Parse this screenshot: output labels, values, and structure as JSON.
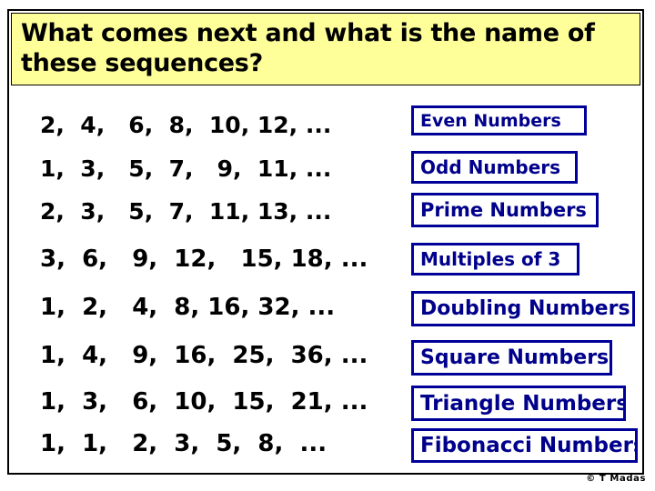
{
  "slide": {
    "title": "What comes next and what is the name of\nthese sequences?",
    "copyright": "© T Madas",
    "colors": {
      "banner_background": "#ffff99",
      "banner_border": "#000000",
      "label_border": "#000099",
      "label_text": "#00008b",
      "sequence_text": "#000000",
      "page_background": "#ffffff"
    }
  },
  "rows": [
    {
      "sequence": "2,  4,   6,  8,  10, 12, ...",
      "terms": [
        2,
        4,
        6,
        8,
        10,
        12
      ],
      "name": "Even Numbers"
    },
    {
      "sequence": "1,  3,   5,  7,   9,  11, ...",
      "terms": [
        1,
        3,
        5,
        7,
        9,
        11
      ],
      "name": "Odd Numbers"
    },
    {
      "sequence": "2,  3,   5,  7,  11, 13, ...",
      "terms": [
        2,
        3,
        5,
        7,
        11,
        13
      ],
      "name": "Prime Numbers"
    },
    {
      "sequence": "3,  6,   9,  12,   15, 18, ...",
      "terms": [
        3,
        6,
        9,
        12,
        15,
        18
      ],
      "name": "Multiples of 3"
    },
    {
      "sequence": "1,  2,   4,  8, 16, 32, ...",
      "terms": [
        1,
        2,
        4,
        8,
        16,
        32
      ],
      "name": "Doubling Numbers"
    },
    {
      "sequence": "1,  4,   9,  16,  25,  36, ...",
      "terms": [
        1,
        4,
        9,
        16,
        25,
        36
      ],
      "name": "Square Numbers"
    },
    {
      "sequence": "1,  3,   6,  10,  15,  21, ...",
      "terms": [
        1,
        3,
        6,
        10,
        15,
        21
      ],
      "name": "Triangle Numbers"
    },
    {
      "sequence": "1,  1,   2,  3,  5,  8,  ...",
      "terms": [
        1,
        1,
        2,
        3,
        5,
        8
      ],
      "name": "Fibonacci Numbers"
    }
  ]
}
